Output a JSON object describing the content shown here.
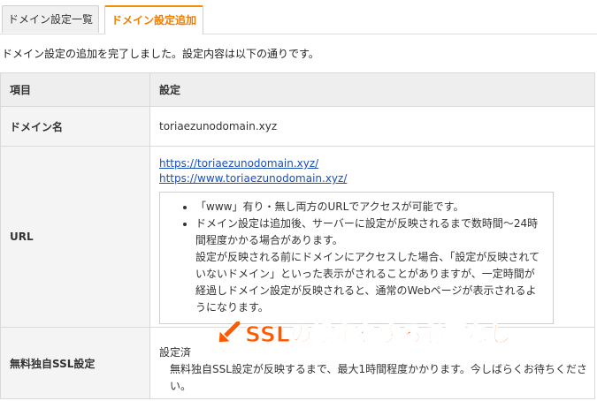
{
  "tabs": {
    "list_label": "ドメイン設定一覧",
    "add_label": "ドメイン設定追加"
  },
  "message": "ドメイン設定の追加を完了しました。設定内容は以下の通りです。",
  "table": {
    "header_item": "項目",
    "header_setting": "設定",
    "domain_label": "ドメイン名",
    "domain_value": "toriaezunodomain.xyz",
    "url_label": "URL",
    "url_links": [
      "https://toriaezunodomain.xyz/",
      "https://www.toriaezunodomain.xyz/"
    ],
    "url_notes": [
      "「www」有り・無し両方のURLでアクセスが可能です。",
      "ドメイン設定は追加後、サーバーに設定が反映されるまで数時間〜24時間程度かかる場合があります。",
      "設定が反映される前にドメインにアクセスした場合、「設定が反映されていないドメイン」といった表示がされることがありますが、一定時間が経過しドメイン設定が反映されると、通常のWebページが表示されるようになります。"
    ],
    "ssl_label": "無料独自SSL設定",
    "ssl_status": "設定済",
    "ssl_note": "無料独自SSL設定が反映するまで、最大1時間程度かかります。今しばらくお待ちください。"
  },
  "annotation": {
    "text": "SSLの設定をする必要なし",
    "color": "#ff5a00"
  }
}
